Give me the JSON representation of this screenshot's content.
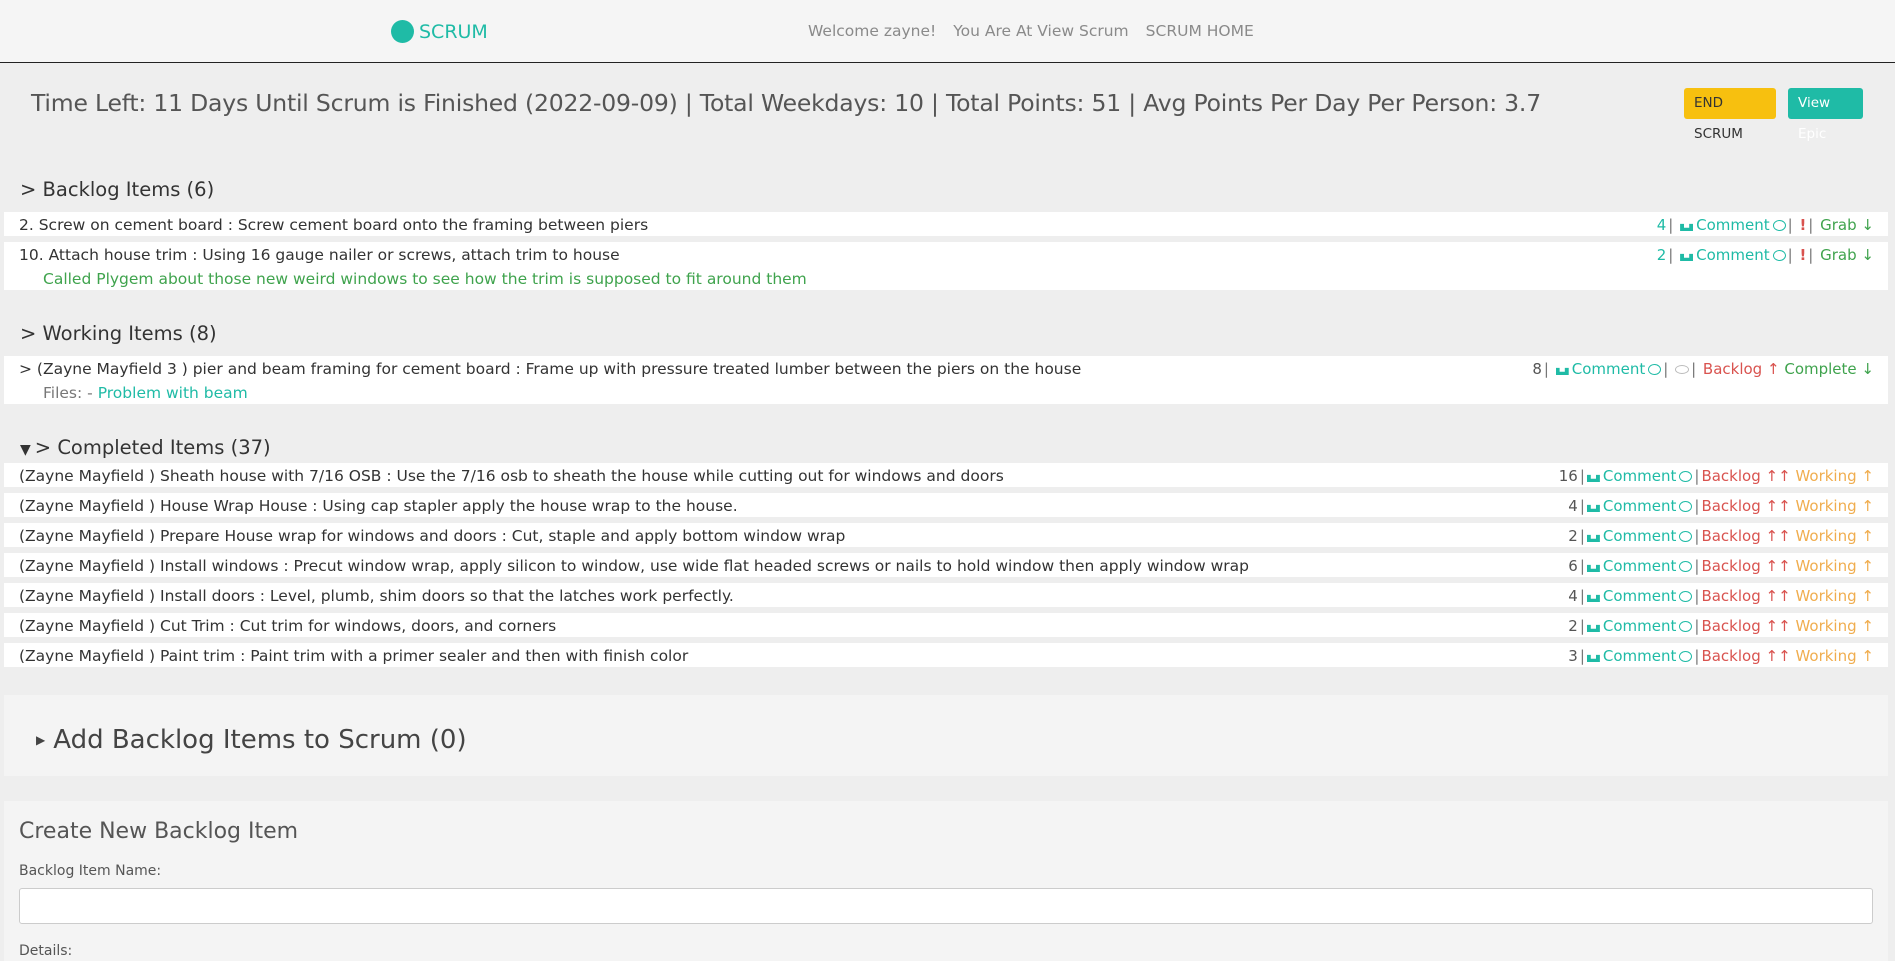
{
  "nav": {
    "brand": "SCRUM",
    "welcome": "Welcome zayne!",
    "location": "You Are At View Scrum",
    "home": "SCRUM HOME"
  },
  "summary": "Time Left: 11 Days Until Scrum is Finished (2022-09-09) | Total Weekdays: 10 | Total Points: 51 | Avg Points Per Day Per Person: 3.7",
  "buttons": {
    "end": "END SCRUM",
    "epic": "View Epic"
  },
  "backlog": {
    "title": "> Backlog Items (6)",
    "items": [
      {
        "text": "2. Screw on cement board : Screw cement board onto the framing between piers",
        "points": "4"
      },
      {
        "text": "10. Attach house trim : Using 16 gauge nailer or screws, attach trim to house",
        "points": "2",
        "note": "Called Plygem about those new weird windows to see how the trim is supposed to fit around them"
      }
    ],
    "comment": "Comment",
    "grab": "Grab"
  },
  "working": {
    "title": "> Working Items (8)",
    "items": [
      {
        "text": "> (Zayne Mayfield 3 ) pier and beam framing for cement board : Frame up with pressure treated lumber between the piers on the house",
        "points": "8",
        "files_label": "Files: -",
        "file": "Problem with beam"
      }
    ],
    "comment": "Comment",
    "backlog": "Backlog",
    "complete": "Complete"
  },
  "completed": {
    "title": "> Completed Items (37)",
    "comment": "Comment",
    "backlog": "Backlog",
    "working": "Working",
    "items": [
      {
        "text": "(Zayne Mayfield ) Sheath house with 7/16 OSB : Use the 7/16 osb to sheath the house while cutting out for windows and doors",
        "points": "16"
      },
      {
        "text": "(Zayne Mayfield ) House Wrap House : Using cap stapler apply the house wrap to the house.",
        "points": "4"
      },
      {
        "text": "(Zayne Mayfield ) Prepare House wrap for windows and doors : Cut, staple and apply bottom window wrap",
        "points": "2"
      },
      {
        "text": "(Zayne Mayfield ) Install windows : Precut window wrap, apply silicon to window, use wide flat headed screws or nails to hold window then apply window wrap",
        "points": "6"
      },
      {
        "text": "(Zayne Mayfield ) Install doors : Level, plumb, shim doors so that the latches work perfectly.",
        "points": "4"
      },
      {
        "text": "(Zayne Mayfield ) Cut Trim : Cut trim for windows, doors, and corners",
        "points": "2"
      },
      {
        "text": "(Zayne Mayfield ) Paint trim : Paint trim with a primer sealer and then with finish color",
        "points": "3"
      }
    ]
  },
  "add": {
    "title": "Add Backlog Items to Scrum (0)"
  },
  "create": {
    "title": "Create New Backlog Item",
    "name_label": "Backlog Item Name:",
    "details_label": "Details:"
  },
  "colors": {
    "teal": "#1fbba6",
    "yellow": "#f7c00f",
    "red": "#d9534f",
    "orange": "#f0ad4e",
    "green": "#3fa34d"
  },
  "icons": [
    "upload-icon",
    "comment-icon",
    "exclamation-icon",
    "eye-icon",
    "arrow-down-icon",
    "arrow-up-icon"
  ]
}
